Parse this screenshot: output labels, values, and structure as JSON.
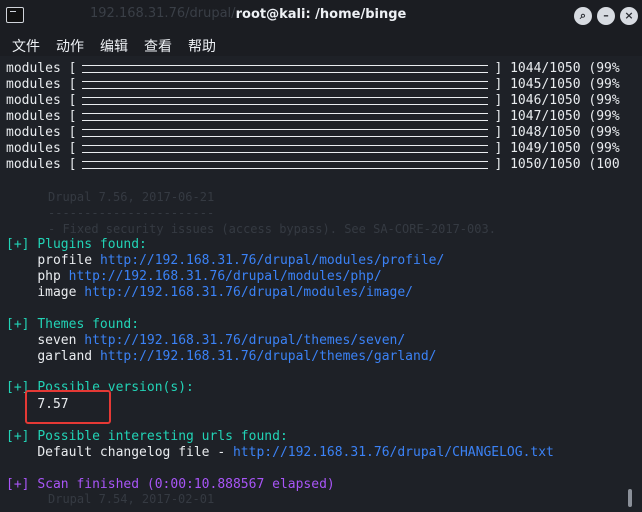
{
  "window": {
    "title": "root@kali: /home/binge",
    "background_tab_title": "192.168.31.76/drupal/",
    "buttons": [
      "search-icon",
      "minimize-icon",
      "maximize-icon",
      "close-icon"
    ]
  },
  "menubar": [
    "文件",
    "动作",
    "编辑",
    "查看",
    "帮助"
  ],
  "progress": [
    {
      "label": "modules",
      "count": "1044/1050",
      "pct": "(99%"
    },
    {
      "label": "modules",
      "count": "1045/1050",
      "pct": "(99%"
    },
    {
      "label": "modules",
      "count": "1046/1050",
      "pct": "(99%"
    },
    {
      "label": "modules",
      "count": "1047/1050",
      "pct": "(99%"
    },
    {
      "label": "modules",
      "count": "1048/1050",
      "pct": "(99%"
    },
    {
      "label": "modules",
      "count": "1049/1050",
      "pct": "(99%"
    },
    {
      "label": "modules",
      "count": "1050/1050",
      "pct": "(100"
    }
  ],
  "plugins": {
    "prefix": "[+]",
    "heading": "Plugins found:",
    "items": [
      {
        "name": "profile",
        "url": "http://192.168.31.76/drupal/modules/profile/"
      },
      {
        "name": "php",
        "url": "http://192.168.31.76/drupal/modules/php/"
      },
      {
        "name": "image",
        "url": "http://192.168.31.76/drupal/modules/image/"
      }
    ]
  },
  "themes": {
    "prefix": "[+]",
    "heading": "Themes found:",
    "items": [
      {
        "name": "seven",
        "url": "http://192.168.31.76/drupal/themes/seven/"
      },
      {
        "name": "garland",
        "url": "http://192.168.31.76/drupal/themes/garland/"
      }
    ]
  },
  "version": {
    "prefix": "[+]",
    "heading": "Possible version(s):",
    "value": "7.57"
  },
  "urls": {
    "prefix": "[+]",
    "heading": "Possible interesting urls found:",
    "label": "Default changelog file - ",
    "url": "http://192.168.31.76/drupal/CHANGELOG.txt"
  },
  "finished": {
    "prefix": "[+]",
    "text": "Scan finished (0:00:10.888567 elapsed)"
  },
  "ghost_lines": [
    "Drupal 7.56, 2017-06-21",
    "-----------------------",
    "- Fixed security issues (access bypass). See SA-CORE-2017-003.",
    "Drupal 7.54, 2017-02-01"
  ],
  "colors": {
    "link": "#3b82f6",
    "heading": "#22d3b6",
    "finished": "#a855f7",
    "highlight_box": "#e53935"
  }
}
